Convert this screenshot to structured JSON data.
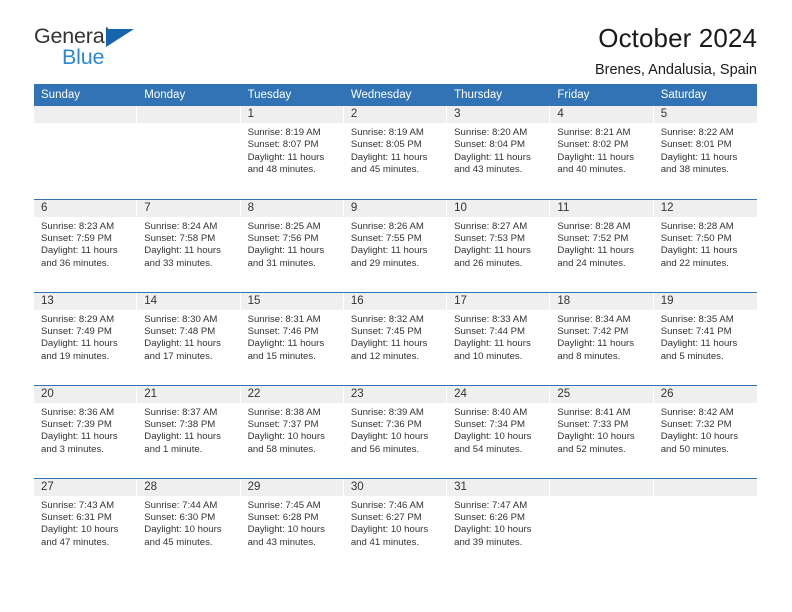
{
  "brand": {
    "name_line1": "General",
    "name_line2": "Blue",
    "accent_color": "#2e87d4",
    "triangle_color": "#1664ab"
  },
  "header": {
    "title": "October 2024",
    "subtitle": "Brenes, Andalusia, Spain"
  },
  "theme": {
    "header_row_bg": "#3273b5",
    "daynum_band_bg": "#efefef",
    "text_color": "#333333"
  },
  "weekday_headers": [
    "Sunday",
    "Monday",
    "Tuesday",
    "Wednesday",
    "Thursday",
    "Friday",
    "Saturday"
  ],
  "weeks": [
    [
      {
        "day": "",
        "empty": true
      },
      {
        "day": "",
        "empty": true
      },
      {
        "day": "1",
        "sunrise": "Sunrise: 8:19 AM",
        "sunset": "Sunset: 8:07 PM",
        "daylight_line1": "Daylight: 11 hours",
        "daylight_line2": "and 48 minutes."
      },
      {
        "day": "2",
        "sunrise": "Sunrise: 8:19 AM",
        "sunset": "Sunset: 8:05 PM",
        "daylight_line1": "Daylight: 11 hours",
        "daylight_line2": "and 45 minutes."
      },
      {
        "day": "3",
        "sunrise": "Sunrise: 8:20 AM",
        "sunset": "Sunset: 8:04 PM",
        "daylight_line1": "Daylight: 11 hours",
        "daylight_line2": "and 43 minutes."
      },
      {
        "day": "4",
        "sunrise": "Sunrise: 8:21 AM",
        "sunset": "Sunset: 8:02 PM",
        "daylight_line1": "Daylight: 11 hours",
        "daylight_line2": "and 40 minutes."
      },
      {
        "day": "5",
        "sunrise": "Sunrise: 8:22 AM",
        "sunset": "Sunset: 8:01 PM",
        "daylight_line1": "Daylight: 11 hours",
        "daylight_line2": "and 38 minutes."
      }
    ],
    [
      {
        "day": "6",
        "sunrise": "Sunrise: 8:23 AM",
        "sunset": "Sunset: 7:59 PM",
        "daylight_line1": "Daylight: 11 hours",
        "daylight_line2": "and 36 minutes."
      },
      {
        "day": "7",
        "sunrise": "Sunrise: 8:24 AM",
        "sunset": "Sunset: 7:58 PM",
        "daylight_line1": "Daylight: 11 hours",
        "daylight_line2": "and 33 minutes."
      },
      {
        "day": "8",
        "sunrise": "Sunrise: 8:25 AM",
        "sunset": "Sunset: 7:56 PM",
        "daylight_line1": "Daylight: 11 hours",
        "daylight_line2": "and 31 minutes."
      },
      {
        "day": "9",
        "sunrise": "Sunrise: 8:26 AM",
        "sunset": "Sunset: 7:55 PM",
        "daylight_line1": "Daylight: 11 hours",
        "daylight_line2": "and 29 minutes."
      },
      {
        "day": "10",
        "sunrise": "Sunrise: 8:27 AM",
        "sunset": "Sunset: 7:53 PM",
        "daylight_line1": "Daylight: 11 hours",
        "daylight_line2": "and 26 minutes."
      },
      {
        "day": "11",
        "sunrise": "Sunrise: 8:28 AM",
        "sunset": "Sunset: 7:52 PM",
        "daylight_line1": "Daylight: 11 hours",
        "daylight_line2": "and 24 minutes."
      },
      {
        "day": "12",
        "sunrise": "Sunrise: 8:28 AM",
        "sunset": "Sunset: 7:50 PM",
        "daylight_line1": "Daylight: 11 hours",
        "daylight_line2": "and 22 minutes."
      }
    ],
    [
      {
        "day": "13",
        "sunrise": "Sunrise: 8:29 AM",
        "sunset": "Sunset: 7:49 PM",
        "daylight_line1": "Daylight: 11 hours",
        "daylight_line2": "and 19 minutes."
      },
      {
        "day": "14",
        "sunrise": "Sunrise: 8:30 AM",
        "sunset": "Sunset: 7:48 PM",
        "daylight_line1": "Daylight: 11 hours",
        "daylight_line2": "and 17 minutes."
      },
      {
        "day": "15",
        "sunrise": "Sunrise: 8:31 AM",
        "sunset": "Sunset: 7:46 PM",
        "daylight_line1": "Daylight: 11 hours",
        "daylight_line2": "and 15 minutes."
      },
      {
        "day": "16",
        "sunrise": "Sunrise: 8:32 AM",
        "sunset": "Sunset: 7:45 PM",
        "daylight_line1": "Daylight: 11 hours",
        "daylight_line2": "and 12 minutes."
      },
      {
        "day": "17",
        "sunrise": "Sunrise: 8:33 AM",
        "sunset": "Sunset: 7:44 PM",
        "daylight_line1": "Daylight: 11 hours",
        "daylight_line2": "and 10 minutes."
      },
      {
        "day": "18",
        "sunrise": "Sunrise: 8:34 AM",
        "sunset": "Sunset: 7:42 PM",
        "daylight_line1": "Daylight: 11 hours",
        "daylight_line2": "and 8 minutes."
      },
      {
        "day": "19",
        "sunrise": "Sunrise: 8:35 AM",
        "sunset": "Sunset: 7:41 PM",
        "daylight_line1": "Daylight: 11 hours",
        "daylight_line2": "and 5 minutes."
      }
    ],
    [
      {
        "day": "20",
        "sunrise": "Sunrise: 8:36 AM",
        "sunset": "Sunset: 7:39 PM",
        "daylight_line1": "Daylight: 11 hours",
        "daylight_line2": "and 3 minutes."
      },
      {
        "day": "21",
        "sunrise": "Sunrise: 8:37 AM",
        "sunset": "Sunset: 7:38 PM",
        "daylight_line1": "Daylight: 11 hours",
        "daylight_line2": "and 1 minute."
      },
      {
        "day": "22",
        "sunrise": "Sunrise: 8:38 AM",
        "sunset": "Sunset: 7:37 PM",
        "daylight_line1": "Daylight: 10 hours",
        "daylight_line2": "and 58 minutes."
      },
      {
        "day": "23",
        "sunrise": "Sunrise: 8:39 AM",
        "sunset": "Sunset: 7:36 PM",
        "daylight_line1": "Daylight: 10 hours",
        "daylight_line2": "and 56 minutes."
      },
      {
        "day": "24",
        "sunrise": "Sunrise: 8:40 AM",
        "sunset": "Sunset: 7:34 PM",
        "daylight_line1": "Daylight: 10 hours",
        "daylight_line2": "and 54 minutes."
      },
      {
        "day": "25",
        "sunrise": "Sunrise: 8:41 AM",
        "sunset": "Sunset: 7:33 PM",
        "daylight_line1": "Daylight: 10 hours",
        "daylight_line2": "and 52 minutes."
      },
      {
        "day": "26",
        "sunrise": "Sunrise: 8:42 AM",
        "sunset": "Sunset: 7:32 PM",
        "daylight_line1": "Daylight: 10 hours",
        "daylight_line2": "and 50 minutes."
      }
    ],
    [
      {
        "day": "27",
        "sunrise": "Sunrise: 7:43 AM",
        "sunset": "Sunset: 6:31 PM",
        "daylight_line1": "Daylight: 10 hours",
        "daylight_line2": "and 47 minutes."
      },
      {
        "day": "28",
        "sunrise": "Sunrise: 7:44 AM",
        "sunset": "Sunset: 6:30 PM",
        "daylight_line1": "Daylight: 10 hours",
        "daylight_line2": "and 45 minutes."
      },
      {
        "day": "29",
        "sunrise": "Sunrise: 7:45 AM",
        "sunset": "Sunset: 6:28 PM",
        "daylight_line1": "Daylight: 10 hours",
        "daylight_line2": "and 43 minutes."
      },
      {
        "day": "30",
        "sunrise": "Sunrise: 7:46 AM",
        "sunset": "Sunset: 6:27 PM",
        "daylight_line1": "Daylight: 10 hours",
        "daylight_line2": "and 41 minutes."
      },
      {
        "day": "31",
        "sunrise": "Sunrise: 7:47 AM",
        "sunset": "Sunset: 6:26 PM",
        "daylight_line1": "Daylight: 10 hours",
        "daylight_line2": "and 39 minutes."
      },
      {
        "day": "",
        "empty": true
      },
      {
        "day": "",
        "empty": true
      }
    ]
  ]
}
